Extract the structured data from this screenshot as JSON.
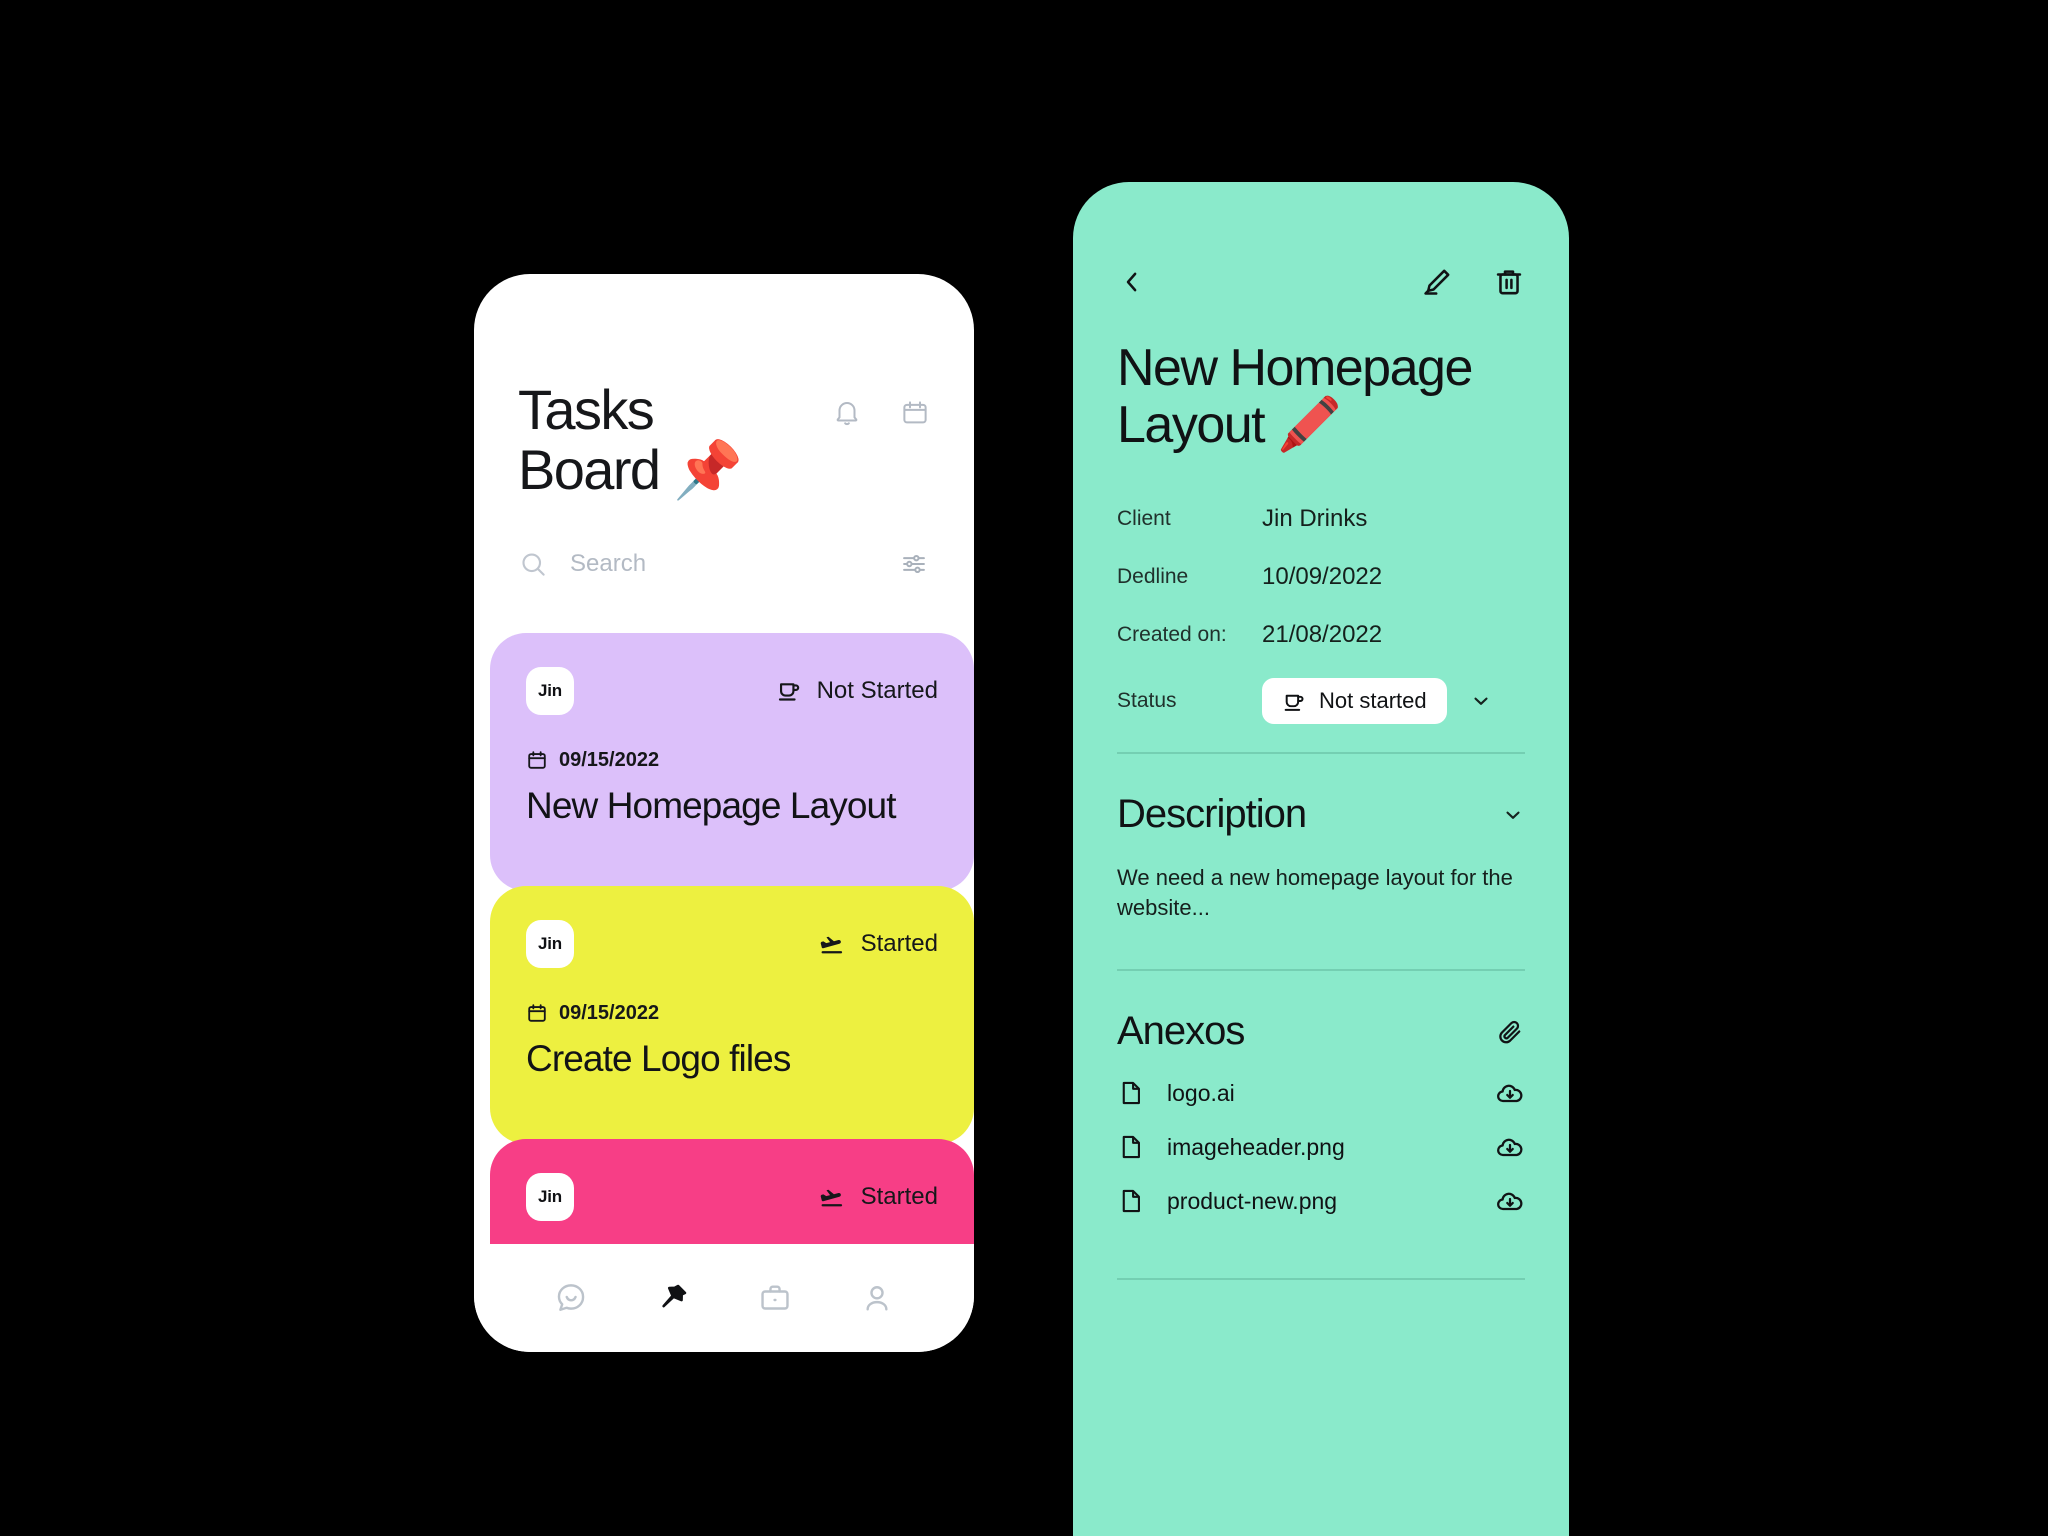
{
  "board": {
    "title": "Tasks Board 📌",
    "icons": {
      "bell": "bell-icon",
      "calendar": "calendar-icon"
    },
    "search": {
      "placeholder": "Search",
      "value": ""
    },
    "cards": [
      {
        "avatar": "Jin",
        "status": "Not Started",
        "status_icon": "coffee-cup-icon",
        "date": "09/15/2022",
        "title": "New Homepage Layout",
        "color": "#DCC0FA"
      },
      {
        "avatar": "Jin",
        "status": "Started",
        "status_icon": "plane-takeoff-icon",
        "date": "09/15/2022",
        "title": "Create Logo files",
        "color": "#EDF040"
      },
      {
        "avatar": "Jin",
        "status": "Started",
        "status_icon": "plane-takeoff-icon",
        "date": "",
        "title": "",
        "color": "#F73E86"
      }
    ],
    "nav": [
      {
        "name": "chat-icon",
        "label": "Chat",
        "active": false
      },
      {
        "name": "pin-icon",
        "label": "Board",
        "active": true
      },
      {
        "name": "briefcase-icon",
        "label": "Work",
        "active": false
      },
      {
        "name": "person-icon",
        "label": "Profile",
        "active": false
      }
    ]
  },
  "detail": {
    "back_label": "Back",
    "edit_label": "Edit",
    "delete_label": "Delete",
    "title": "New Homepage Layout 🖍️",
    "meta": [
      {
        "key": "Client",
        "value": "Jin Drinks"
      },
      {
        "key": "Dedline",
        "value": "10/09/2022"
      },
      {
        "key": "Created on:",
        "value": "21/08/2022"
      }
    ],
    "status": {
      "key": "Status",
      "value": "Not started",
      "icon": "coffee-cup-icon"
    },
    "description": {
      "heading": "Description",
      "body": "We need a new homepage layout for the website..."
    },
    "attachments": {
      "heading": "Anexos",
      "files": [
        {
          "name": "logo.ai"
        },
        {
          "name": "imageheader.png"
        },
        {
          "name": "product-new.png"
        }
      ]
    }
  },
  "colors": {
    "mint": "#8AEACB",
    "purple": "#DCC0FA",
    "yellow": "#EDF040",
    "pink": "#F73E86",
    "ink": "#101214"
  }
}
